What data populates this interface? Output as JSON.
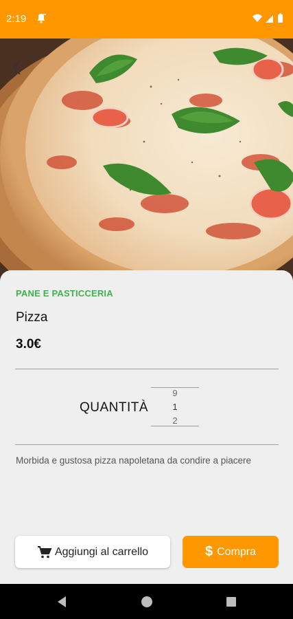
{
  "status_bar": {
    "time": "2:19",
    "bg_color": "#ff9800"
  },
  "hero": {
    "image": "pizza-photo"
  },
  "product": {
    "category": "PANE E PASTICCERIA",
    "name": "Pizza",
    "price": "3.0€",
    "description": "Morbida e gustosa pizza napoletana da condire a piacere"
  },
  "quantity": {
    "label": "QUANTITÀ",
    "prev": "9",
    "current": "1",
    "next": "2"
  },
  "actions": {
    "add_to_cart": "Aggiungi al carrello",
    "buy": "Compra"
  },
  "colors": {
    "accent": "#ff9800",
    "category": "#3db34a"
  }
}
